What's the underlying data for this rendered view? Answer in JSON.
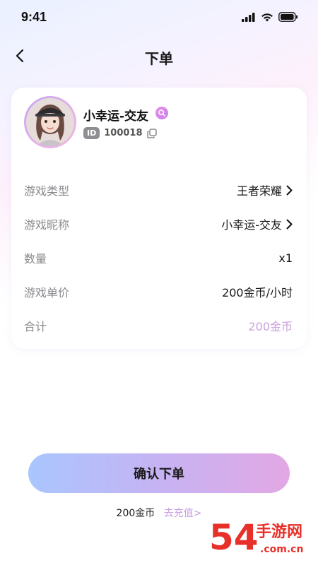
{
  "status": {
    "time": "9:41"
  },
  "nav": {
    "title": "下单"
  },
  "user": {
    "name": "小幸运-交友",
    "id_badge": "ID",
    "id_value": "100018"
  },
  "order": {
    "rows": [
      {
        "label": "游戏类型",
        "value": "王者荣耀",
        "has_arrow": true
      },
      {
        "label": "游戏昵称",
        "value": "小幸运-交友",
        "has_arrow": true
      },
      {
        "label": "数量",
        "value": "x1",
        "has_arrow": false
      },
      {
        "label": "游戏单价",
        "value": "200金币/小时",
        "has_arrow": false
      },
      {
        "label": "合计",
        "value": "200金币",
        "has_arrow": false
      }
    ]
  },
  "actions": {
    "confirm_label": "确认下单"
  },
  "balance": {
    "value": "200金币",
    "recharge_label": "去充值>"
  },
  "watermark": {
    "text_main": "手游网",
    "text_sub": ".com.cn",
    "number": "54"
  },
  "colors": {
    "accent_pink": "#c9a2de",
    "button_gradient_start": "#a9c6ff",
    "button_gradient_end": "#e2a8e4",
    "watermark_red": "#e8302a"
  }
}
